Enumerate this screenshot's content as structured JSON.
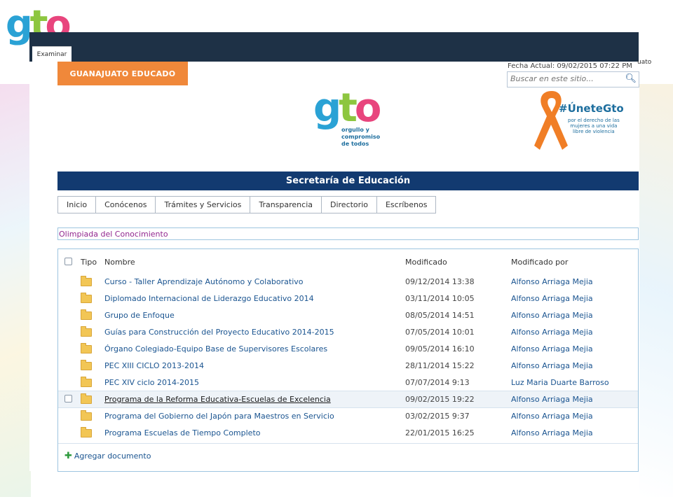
{
  "window": {
    "tab_label": "Examinar"
  },
  "header": {
    "brand_button": "GUANAJUATO EDUCADO",
    "date_label": "Fecha Actual: 09/02/2015 07:22 PM",
    "search_placeholder": "Buscar en este sitio...",
    "side_text": "uato",
    "logo_mark": "gto",
    "logo_tagline": "orgullo y compromiso de todos",
    "campaign_hashtag": "#ÚneteGto",
    "campaign_sub": "por el derecho de las mujeres a una vida libre de violencia"
  },
  "section_bar": "Secretaría de Educación",
  "nav": [
    "Inicio",
    "Conócenos",
    "Trámites y Servicios",
    "Transparencia",
    "Directorio",
    "Escríbenos"
  ],
  "page_title": "Olimpiada del Conocimiento",
  "list": {
    "columns": {
      "type": "Tipo",
      "name": "Nombre",
      "modified": "Modificado",
      "modified_by": "Modificado por"
    },
    "rows": [
      {
        "name": "Curso - Taller Aprendizaje Autónomo y Colaborativo",
        "modified": "09/12/2014 13:38",
        "modified_by": "Alfonso Arriaga Mejia"
      },
      {
        "name": "Diplomado Internacional de Liderazgo Educativo 2014",
        "modified": "03/11/2014 10:05",
        "modified_by": "Alfonso Arriaga Mejia"
      },
      {
        "name": "Grupo de Enfoque",
        "modified": "08/05/2014 14:51",
        "modified_by": "Alfonso Arriaga Mejia"
      },
      {
        "name": "Guías para Construcción del Proyecto Educativo 2014-2015",
        "modified": "07/05/2014 10:01",
        "modified_by": "Alfonso Arriaga Mejia"
      },
      {
        "name": "Órgano Colegiado-Equipo Base de Supervisores Escolares",
        "modified": "09/05/2014 16:10",
        "modified_by": "Alfonso Arriaga Mejia"
      },
      {
        "name": "PEC XIII CICLO 2013-2014",
        "modified": "28/11/2014 15:22",
        "modified_by": "Alfonso Arriaga Mejia"
      },
      {
        "name": "PEC XIV ciclo 2014-2015",
        "modified": "07/07/2014 9:13",
        "modified_by": "Luz Maria Duarte Barroso"
      },
      {
        "name": "Programa de la Reforma Educativa-Escuelas de Excelencia",
        "modified": "09/02/2015 19:22",
        "modified_by": "Alfonso Arriaga Mejia",
        "selected": true
      },
      {
        "name": "Programa del Gobierno del Japón para Maestros en Servicio",
        "modified": "03/02/2015 9:37",
        "modified_by": "Alfonso Arriaga Mejia"
      },
      {
        "name": "Programa Escuelas de Tiempo Completo",
        "modified": "22/01/2015 16:25",
        "modified_by": "Alfonso Arriaga Mejia"
      }
    ],
    "add_document": "Agregar documento"
  }
}
